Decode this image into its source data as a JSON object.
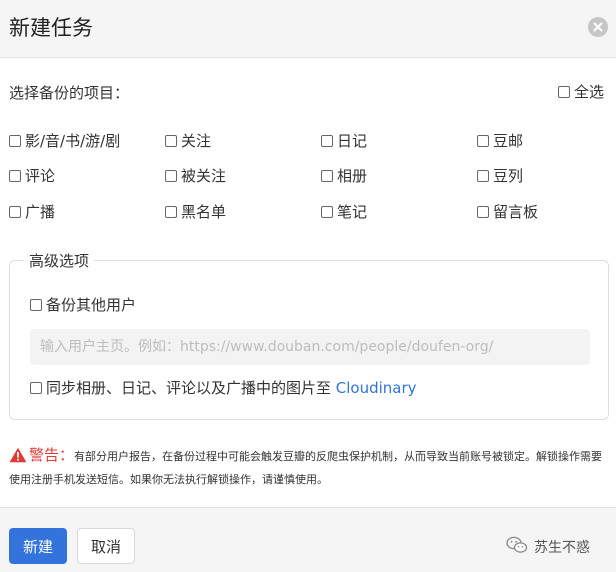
{
  "dialog": {
    "title": "新建任务",
    "close_icon": "close-icon"
  },
  "select": {
    "label": "选择备份的项目：",
    "all_label": "全选",
    "all_checked": false
  },
  "options": [
    {
      "label": "影/音/书/游/剧",
      "checked": false
    },
    {
      "label": "关注",
      "checked": false
    },
    {
      "label": "日记",
      "checked": false
    },
    {
      "label": "豆邮",
      "checked": false
    },
    {
      "label": "评论",
      "checked": false
    },
    {
      "label": "被关注",
      "checked": false
    },
    {
      "label": "相册",
      "checked": false
    },
    {
      "label": "豆列",
      "checked": false
    },
    {
      "label": "广播",
      "checked": false
    },
    {
      "label": "黑名单",
      "checked": false
    },
    {
      "label": "笔记",
      "checked": false
    },
    {
      "label": "留言板",
      "checked": false
    }
  ],
  "advanced": {
    "legend": "高级选项",
    "backup_other_label": "备份其他用户",
    "backup_other_checked": false,
    "user_input_placeholder": "输入用户主页。例如：https://www.douban.com/people/doufen-org/",
    "user_input_value": "",
    "sync_prefix": "同步相册、日记、评论以及广播中的图片至 ",
    "sync_link": "Cloudinary",
    "sync_checked": false
  },
  "warning": {
    "icon": "warning-icon",
    "title": "警告",
    "colon": "：",
    "text": "有部分用户报告，在备份过程中可能会触发豆瓣的反爬虫保护机制，从而导致当前账号被锁定。解锁操作需要使用注册手机发送短信。如果你无法执行解锁操作，请谨慎使用。"
  },
  "footer": {
    "create_label": "新建",
    "cancel_label": "取消",
    "watermark_text": "苏生不惑",
    "watermark_icon": "wechat-icon"
  },
  "colors": {
    "primary": "#3273dc",
    "warning": "#e53935",
    "header_bg": "#f5f5f5"
  }
}
